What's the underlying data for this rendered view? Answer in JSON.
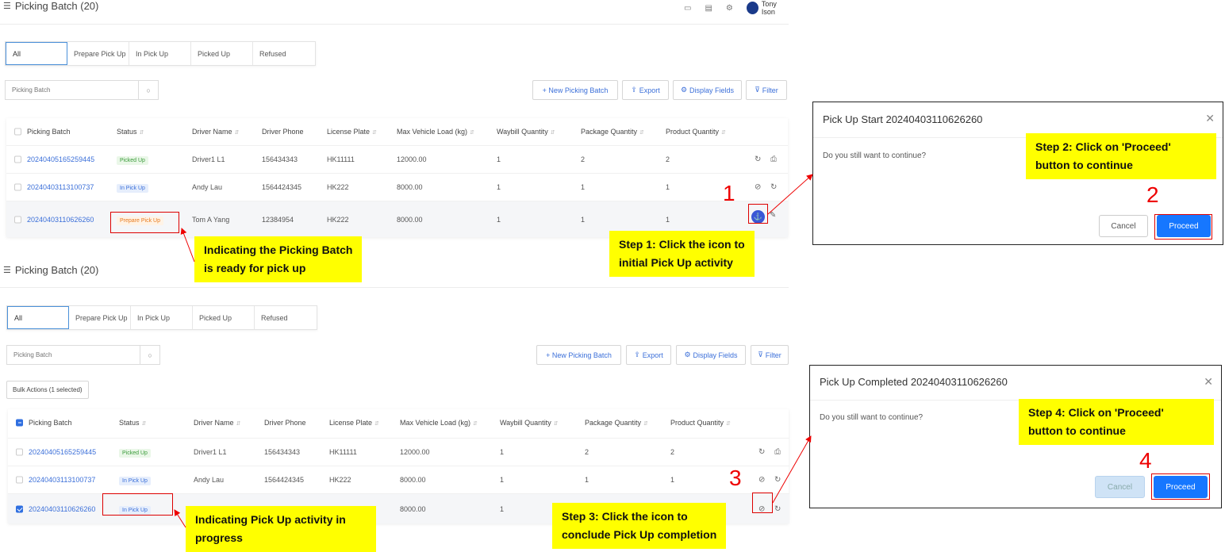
{
  "top": {
    "title": "Picking Batch (20)",
    "user_name": "Tony Ison",
    "icons": [
      "folder-icon",
      "document-icon",
      "settings-icon"
    ]
  },
  "tabs": [
    "All",
    "Prepare Pick Up",
    "In Pick Up",
    "Picked Up",
    "Refused"
  ],
  "search_placeholder": "Picking Batch",
  "toolbar": {
    "new_batch": "+ New Picking Batch",
    "export": "Export",
    "display_fields": "Display Fields",
    "filter": "Filter",
    "bulk_actions": "Bulk Actions (1 selected)"
  },
  "columns": [
    "Picking Batch",
    "Status",
    "Driver Name",
    "Driver Phone",
    "License Plate",
    "Max Vehicle Load (kg)",
    "Waybill Quantity",
    "Package Quantity",
    "Product Quantity"
  ],
  "panel1_rows": [
    {
      "batch": "20240405165259445",
      "status": "Picked Up",
      "driver": "Driver1 L1",
      "phone": "156434343",
      "plate": "HK11111",
      "load": "12000.00",
      "waybill": "1",
      "package": "2",
      "product": "2"
    },
    {
      "batch": "20240403113100737",
      "status": "In Pick Up",
      "driver": "Andy Lau",
      "phone": "1564424345",
      "plate": "HK222",
      "load": "8000.00",
      "waybill": "1",
      "package": "1",
      "product": "1"
    },
    {
      "batch": "20240403110626260",
      "status": "Prepare Pick Up",
      "driver": "Tom A Yang",
      "phone": "12384954",
      "plate": "HK222",
      "load": "8000.00",
      "waybill": "1",
      "package": "1",
      "product": "1"
    }
  ],
  "panel2_rows": [
    {
      "batch": "20240405165259445",
      "status": "Picked Up",
      "driver": "Driver1 L1",
      "phone": "156434343",
      "plate": "HK11111",
      "load": "12000.00",
      "waybill": "1",
      "package": "2",
      "product": "2"
    },
    {
      "batch": "20240403113100737",
      "status": "In Pick Up",
      "driver": "Andy Lau",
      "phone": "1564424345",
      "plate": "HK222",
      "load": "8000.00",
      "waybill": "1",
      "package": "1",
      "product": "1"
    },
    {
      "batch": "20240403110626260",
      "status": "In Pick Up",
      "driver": "",
      "phone": "",
      "plate": "",
      "load": "8000.00",
      "waybill": "1",
      "package": "1",
      "product": "1"
    }
  ],
  "dialog1": {
    "title": "Pick Up Start 20240403110626260",
    "question": "Do you still want to continue?",
    "cancel": "Cancel",
    "proceed": "Proceed"
  },
  "dialog2": {
    "title": "Pick Up Completed 20240403110626260",
    "question": "Do you still want to continue?",
    "cancel": "Cancel",
    "proceed": "Proceed"
  },
  "callouts": {
    "ready": [
      "Indicating the Picking Batch",
      "is ready for pick up"
    ],
    "step1": [
      "Step 1: Click the icon to",
      "initial Pick Up activity"
    ],
    "step2": [
      "Step 2: Click on 'Proceed'",
      "button to continue"
    ],
    "progress": [
      "Indicating Pick Up activity in",
      "progress"
    ],
    "step3": [
      "Step 3: Click the icon to",
      "conclude Pick Up completion"
    ],
    "step4": [
      "Step 4: Click on 'Proceed'",
      "button to continue"
    ]
  },
  "step_numbers": [
    "1",
    "2",
    "3",
    "4"
  ],
  "colors": {
    "accent": "#1677ff",
    "callout": "#ffff00",
    "annotation": "#dd0000",
    "link": "#3b6fd9"
  }
}
